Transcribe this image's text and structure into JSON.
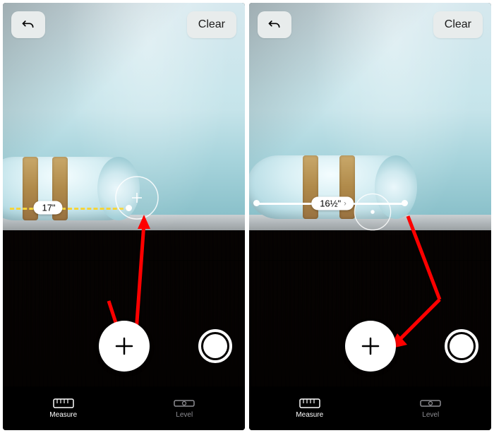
{
  "panels": [
    {
      "id": "left",
      "clear_label": "Clear",
      "measurement": "17\"",
      "measure_complete": false,
      "tabs": {
        "measure": "Measure",
        "level": "Level",
        "active": "measure"
      }
    },
    {
      "id": "right",
      "clear_label": "Clear",
      "measurement": "16½\"",
      "measure_complete": true,
      "tabs": {
        "measure": "Measure",
        "level": "Level",
        "active": "measure"
      }
    }
  ],
  "icons": {
    "undo": "undo-icon",
    "plus": "plus-icon",
    "shutter": "shutter-icon",
    "ruler": "ruler-icon",
    "level": "level-icon",
    "chevron": "›",
    "reticle": "reticle-icon"
  },
  "colors": {
    "arrow": "#ff0000",
    "dashed_line": "#f5d43a",
    "solid_line": "#ffffff",
    "pill_bg": "#e8ecec"
  }
}
